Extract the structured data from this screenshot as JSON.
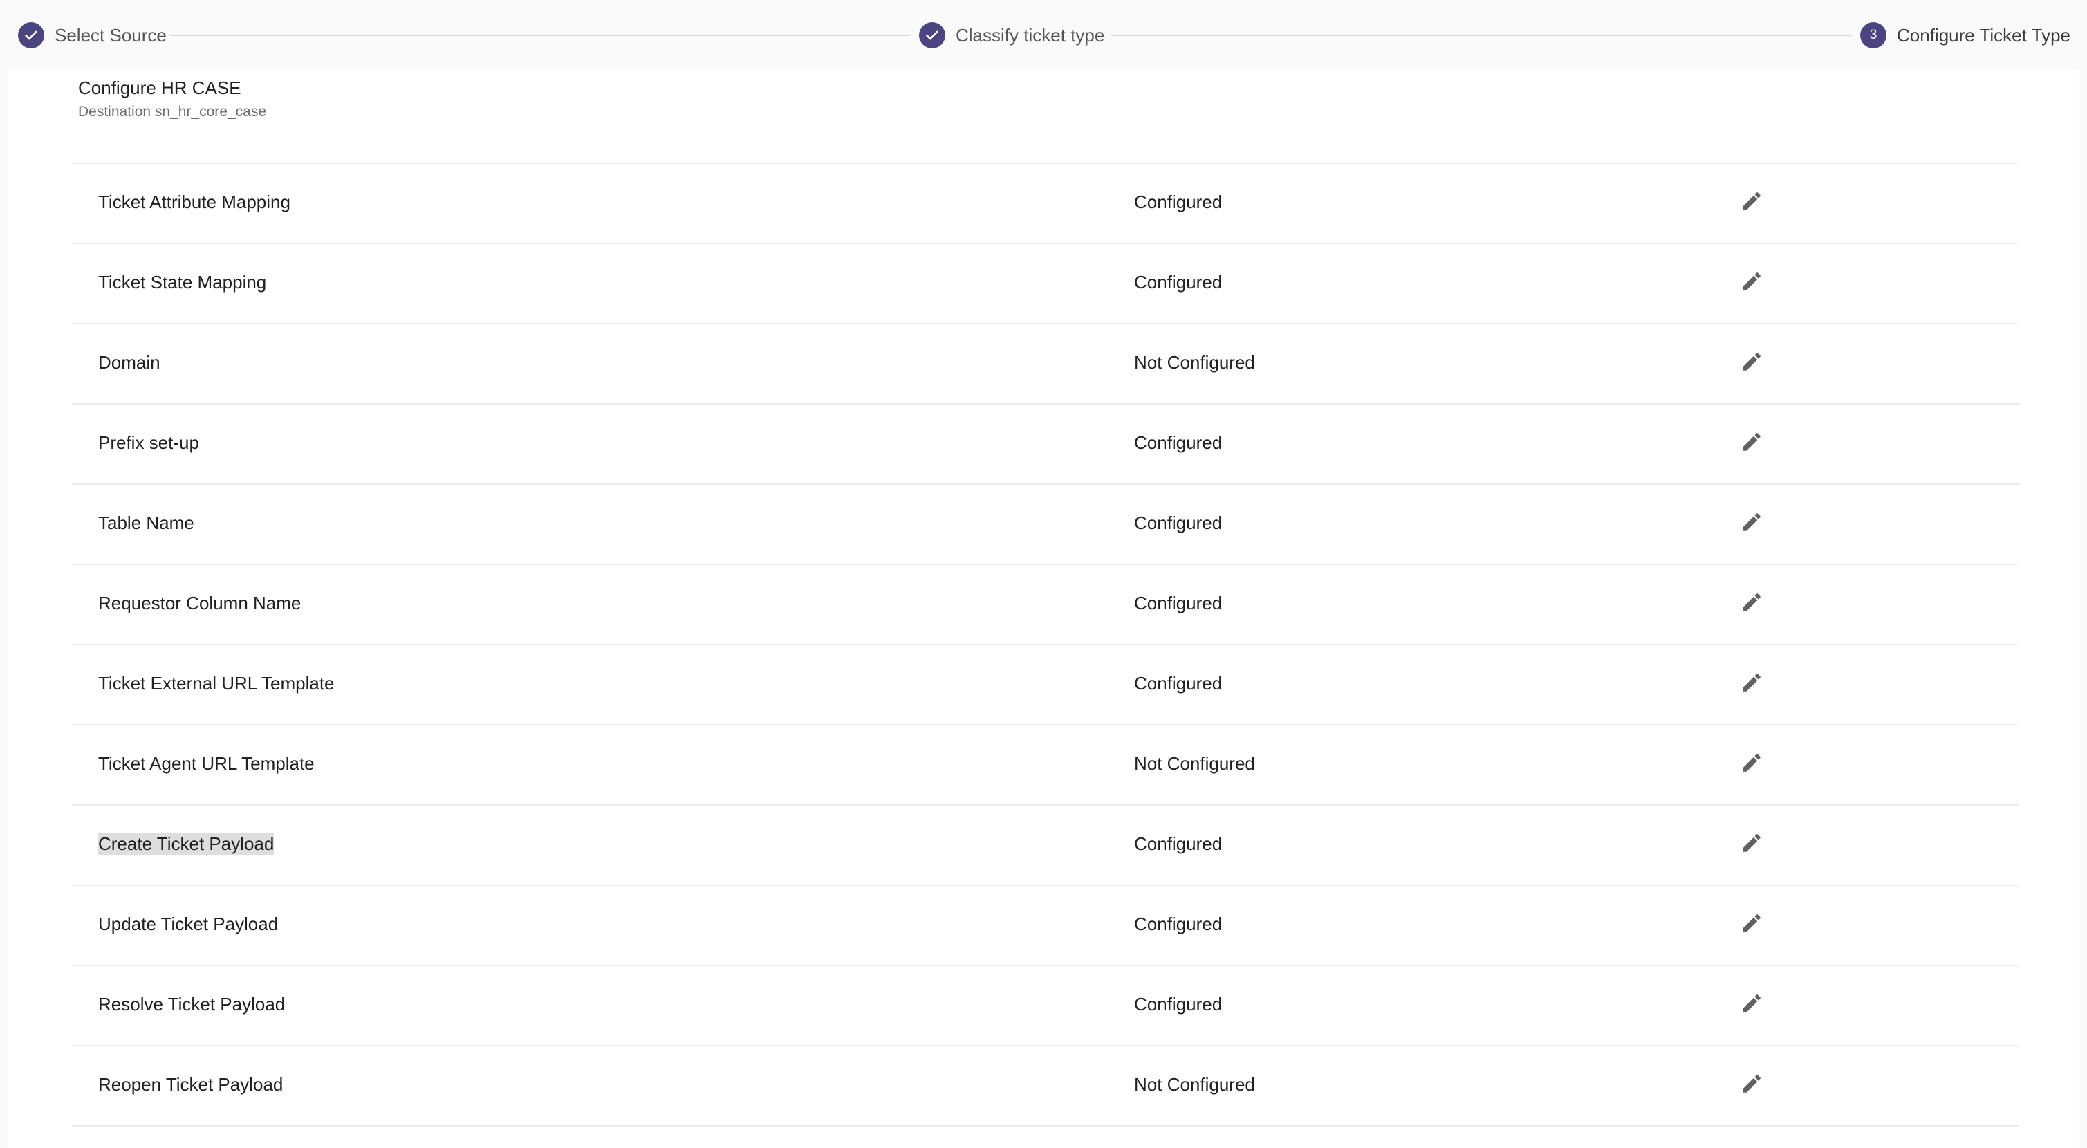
{
  "stepper": {
    "steps": [
      {
        "label": "Select Source",
        "state": "completed",
        "icon": "check-icon"
      },
      {
        "label": "Classify ticket type",
        "state": "completed",
        "icon": "check-icon"
      },
      {
        "label": "Configure Ticket Type",
        "state": "active",
        "number": "3"
      }
    ]
  },
  "page": {
    "title": "Configure HR CASE",
    "subtitle": "Destination sn_hr_core_case"
  },
  "rows": [
    {
      "name": "Ticket Attribute Mapping",
      "status": "Configured",
      "icon": "pencil-icon"
    },
    {
      "name": "Ticket State Mapping",
      "status": "Configured",
      "icon": "pencil-icon"
    },
    {
      "name": "Domain",
      "status": "Not Configured",
      "icon": "pencil-icon"
    },
    {
      "name": "Prefix set-up",
      "status": "Configured",
      "icon": "pencil-icon"
    },
    {
      "name": "Table Name",
      "status": "Configured",
      "icon": "pencil-icon"
    },
    {
      "name": "Requestor Column Name",
      "status": "Configured",
      "icon": "pencil-icon"
    },
    {
      "name": "Ticket External URL Template",
      "status": "Configured",
      "icon": "pencil-icon"
    },
    {
      "name": "Ticket Agent URL Template",
      "status": "Not Configured",
      "icon": "pencil-icon"
    },
    {
      "name": "Create Ticket Payload",
      "status": "Configured",
      "icon": "pencil-icon",
      "highlighted": true
    },
    {
      "name": "Update Ticket Payload",
      "status": "Configured",
      "icon": "pencil-icon"
    },
    {
      "name": "Resolve Ticket Payload",
      "status": "Configured",
      "icon": "pencil-icon"
    },
    {
      "name": "Reopen Ticket Payload",
      "status": "Not Configured",
      "icon": "pencil-icon"
    }
  ],
  "colors": {
    "accent": "#4a4580",
    "icon": "#616161",
    "divider": "#ececec",
    "background": "#fafafa"
  }
}
